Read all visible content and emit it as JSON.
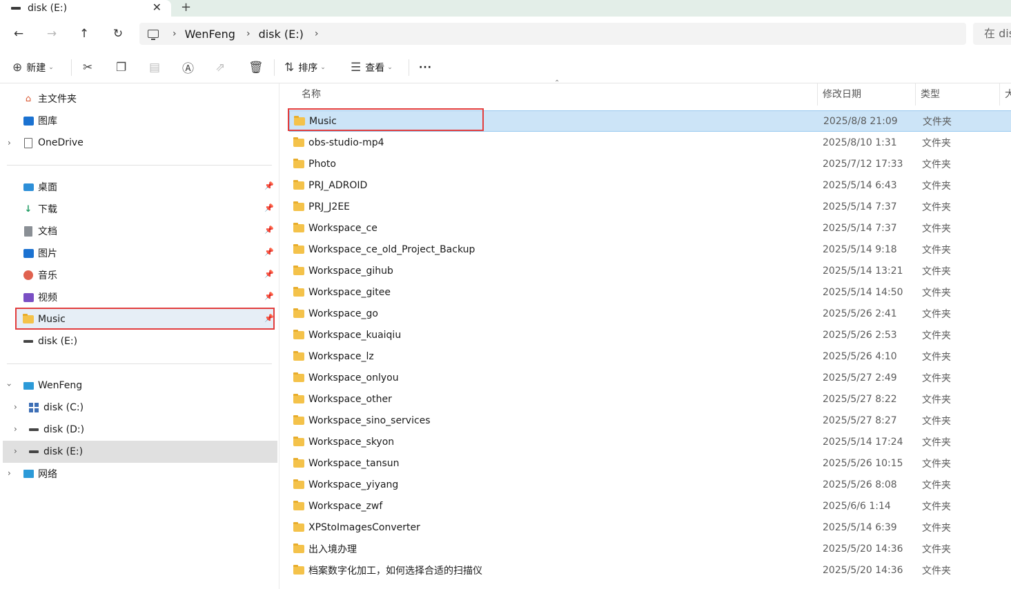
{
  "window": {
    "tab_title": "disk (E:)",
    "tab_close": "✕",
    "new_tab": "+"
  },
  "nav": {
    "back": "←",
    "forward": "→",
    "up": "↑",
    "refresh": "↻",
    "breadcrumbs": [
      "WenFeng",
      "disk (E:)"
    ],
    "separator": "›",
    "search_placeholder": "在 disk (E:) 中搜索"
  },
  "toolbar": {
    "new_label": "新建",
    "sort_label": "排序",
    "view_label": "查看",
    "more": "···",
    "icons": [
      "cut-icon",
      "copy-icon",
      "paste-icon",
      "rename-icon",
      "share-icon",
      "delete-icon"
    ]
  },
  "sidebar": {
    "top_items": [
      {
        "label": "主文件夹",
        "icon": "home-icon"
      },
      {
        "label": "图库",
        "icon": "gallery-icon"
      },
      {
        "label": "OneDrive",
        "icon": "document-icon"
      }
    ],
    "quick_access": [
      {
        "label": "桌面",
        "icon": "desktop-icon"
      },
      {
        "label": "下载",
        "icon": "download-icon"
      },
      {
        "label": "文档",
        "icon": "documents-icon"
      },
      {
        "label": "图片",
        "icon": "pictures-icon"
      },
      {
        "label": "音乐",
        "icon": "music-icon"
      },
      {
        "label": "视频",
        "icon": "video-icon"
      },
      {
        "label": "Music",
        "icon": "folder-icon"
      },
      {
        "label": "disk (E:)",
        "icon": "drive-icon"
      }
    ],
    "this_pc": {
      "label": "WenFeng",
      "drives": [
        "disk (C:)",
        "disk (D:)",
        "disk (E:)"
      ]
    },
    "network": "网络"
  },
  "columns": {
    "name": "名称",
    "date": "修改日期",
    "type": "类型",
    "size": "大"
  },
  "files": [
    {
      "name": "Music",
      "date": "2025/8/8 21:09",
      "type": "文件夹"
    },
    {
      "name": "obs-studio-mp4",
      "date": "2025/8/10 1:31",
      "type": "文件夹"
    },
    {
      "name": "Photo",
      "date": "2025/7/12 17:33",
      "type": "文件夹"
    },
    {
      "name": "PRJ_ADROID",
      "date": "2025/5/14 6:43",
      "type": "文件夹"
    },
    {
      "name": "PRJ_J2EE",
      "date": "2025/5/14 7:37",
      "type": "文件夹"
    },
    {
      "name": "Workspace_ce",
      "date": "2025/5/14 7:37",
      "type": "文件夹"
    },
    {
      "name": "Workspace_ce_old_Project_Backup",
      "date": "2025/5/14 9:18",
      "type": "文件夹"
    },
    {
      "name": "Workspace_gihub",
      "date": "2025/5/14 13:21",
      "type": "文件夹"
    },
    {
      "name": "Workspace_gitee",
      "date": "2025/5/14 14:50",
      "type": "文件夹"
    },
    {
      "name": "Workspace_go",
      "date": "2025/5/26 2:41",
      "type": "文件夹"
    },
    {
      "name": "Workspace_kuaiqiu",
      "date": "2025/5/26 2:53",
      "type": "文件夹"
    },
    {
      "name": "Workspace_lz",
      "date": "2025/5/26 4:10",
      "type": "文件夹"
    },
    {
      "name": "Workspace_onlyou",
      "date": "2025/5/27 2:49",
      "type": "文件夹"
    },
    {
      "name": "Workspace_other",
      "date": "2025/5/27 8:22",
      "type": "文件夹"
    },
    {
      "name": "Workspace_sino_services",
      "date": "2025/5/27 8:27",
      "type": "文件夹"
    },
    {
      "name": "Workspace_skyon",
      "date": "2025/5/14 17:24",
      "type": "文件夹"
    },
    {
      "name": "Workspace_tansun",
      "date": "2025/5/26 10:15",
      "type": "文件夹"
    },
    {
      "name": "Workspace_yiyang",
      "date": "2025/5/26 8:08",
      "type": "文件夹"
    },
    {
      "name": "Workspace_zwf",
      "date": "2025/6/6 1:14",
      "type": "文件夹"
    },
    {
      "name": "XPStoImagesConverter",
      "date": "2025/5/14 6:39",
      "type": "文件夹"
    },
    {
      "name": "出入境办理",
      "date": "2025/5/20 14:36",
      "type": "文件夹"
    },
    {
      "name": "档案数字化加工，如何选择合适的扫描仪",
      "date": "2025/5/20 14:36",
      "type": "文件夹"
    }
  ],
  "colors": {
    "selection": "#cce4f7",
    "highlight_box": "#e23c3c",
    "folder": "#f4c24a"
  }
}
